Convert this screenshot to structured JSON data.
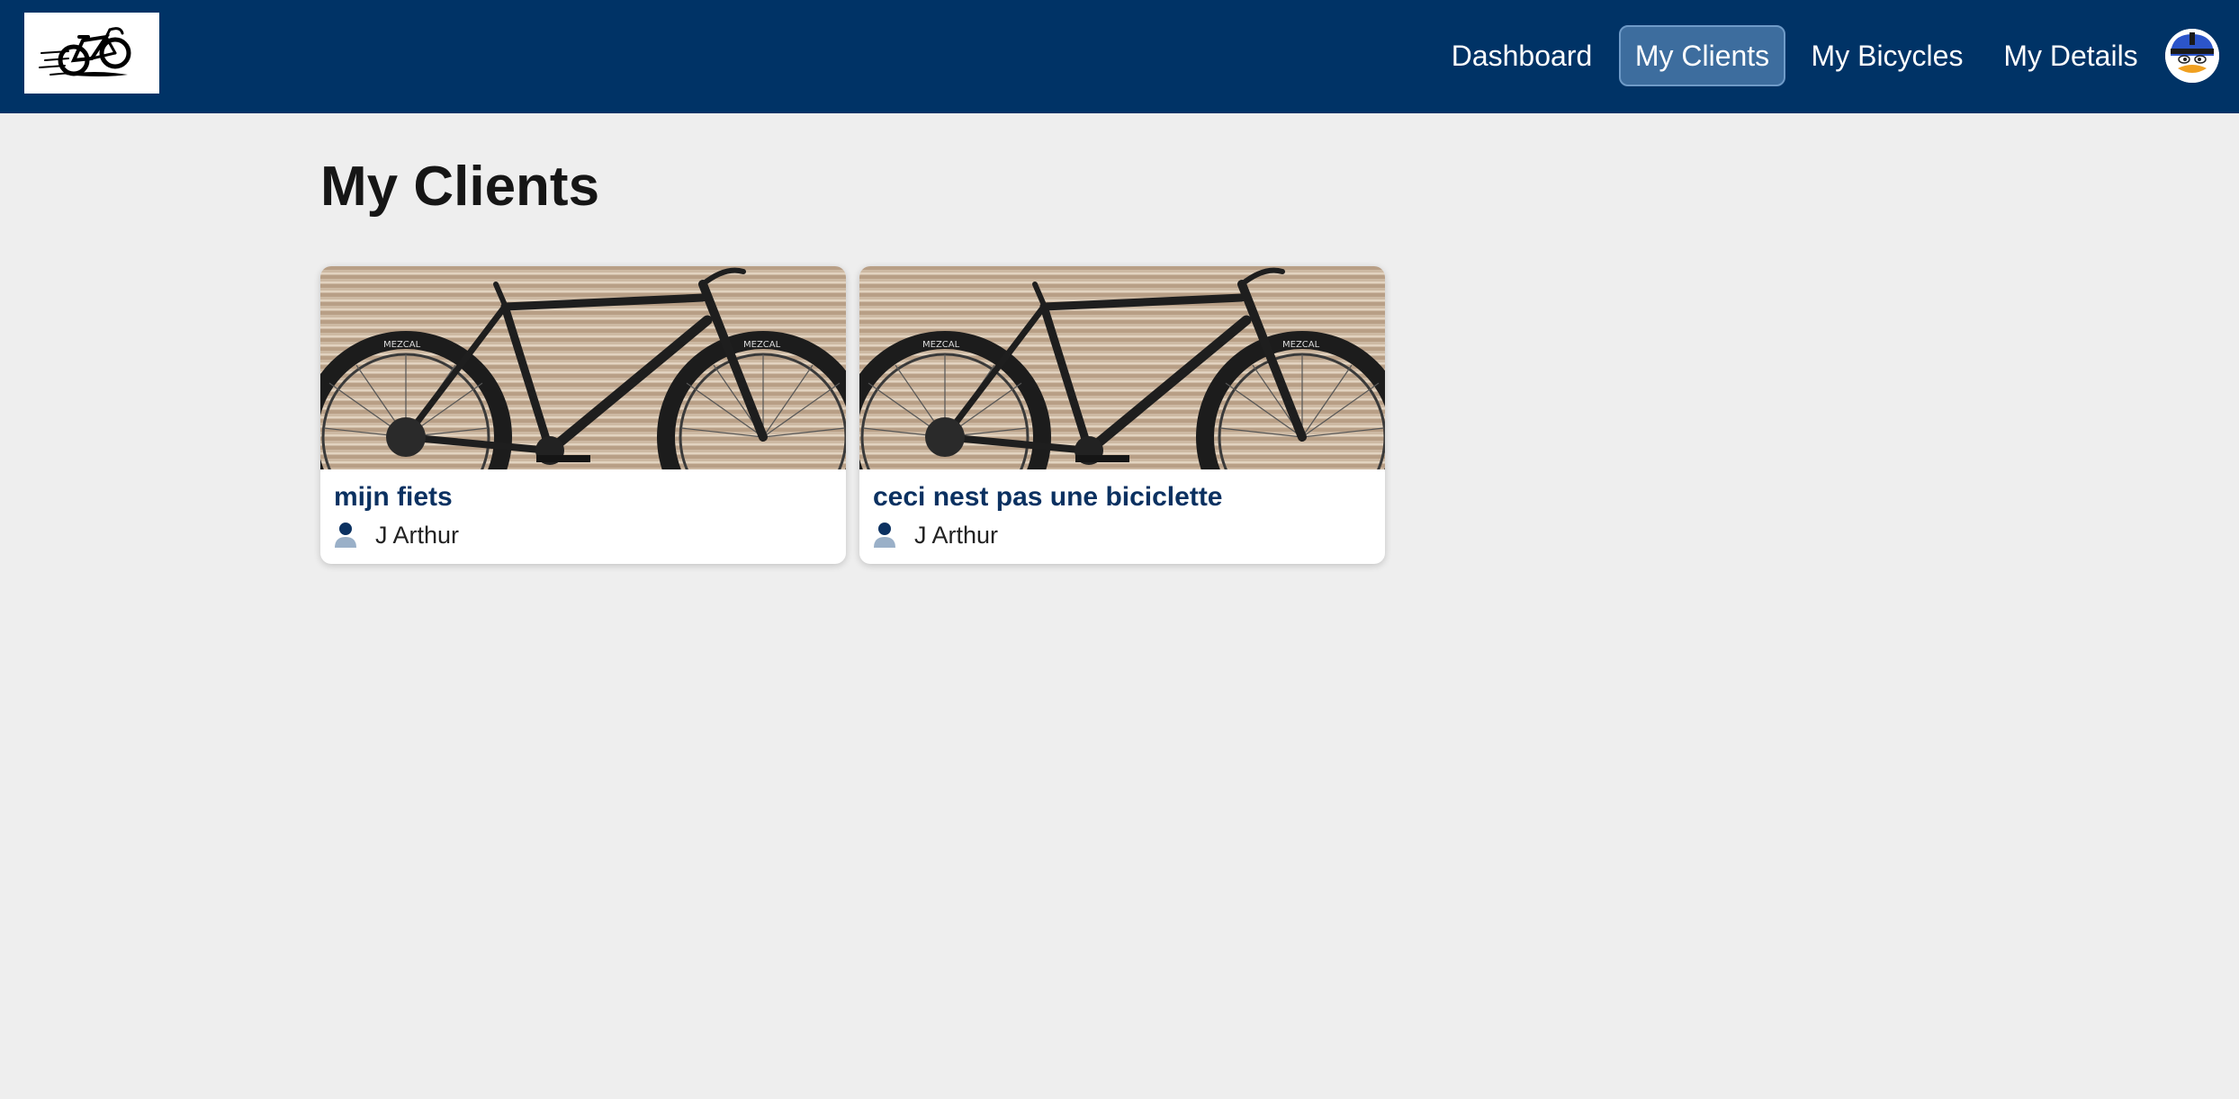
{
  "header": {
    "logo_icon": "bicycle-logo-icon",
    "nav": [
      {
        "label": "Dashboard",
        "active": false
      },
      {
        "label": "My Clients",
        "active": true
      },
      {
        "label": "My Bicycles",
        "active": false
      },
      {
        "label": "My Details",
        "active": false
      }
    ],
    "avatar_icon": "duck-avatar-icon"
  },
  "page": {
    "title": "My Clients"
  },
  "clients": [
    {
      "bicycle_name": "mijn fiets",
      "owner": "J Arthur",
      "owner_icon": "person-icon",
      "image": "bicycle-photo"
    },
    {
      "bicycle_name": "ceci nest pas une biciclette",
      "owner": "J Arthur",
      "owner_icon": "person-icon",
      "image": "bicycle-photo"
    }
  ],
  "colors": {
    "header_bg": "#003366",
    "active_tab_bg": "#3d6d9e",
    "page_bg": "#eeeeee",
    "card_title": "#0b3161"
  }
}
